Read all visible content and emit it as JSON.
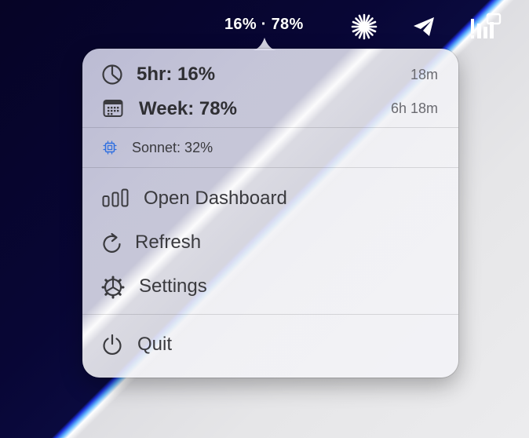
{
  "menubar": {
    "status_text": "16% · 78%",
    "icons": [
      "asterisk-burst-icon",
      "telegram-icon",
      "stats-bars-icon"
    ]
  },
  "popup": {
    "five_hour": {
      "label": "5hr: 16%",
      "reset": "18m",
      "icon": "pie-clock-icon"
    },
    "week": {
      "label": "Week: 78%",
      "reset": "6h 18m",
      "icon": "calendar-icon"
    },
    "model": {
      "label": "Sonnet: 32%",
      "icon": "cpu-chip-icon",
      "icon_color": "#2f6fe0"
    },
    "menu": {
      "open_dashboard": "Open Dashboard",
      "refresh": "Refresh",
      "settings": "Settings",
      "quit": "Quit"
    }
  },
  "colors": {
    "wallpaper_dark": "#060426",
    "accent_blue": "#2f6fe0",
    "panel": "#f4f3f7"
  }
}
